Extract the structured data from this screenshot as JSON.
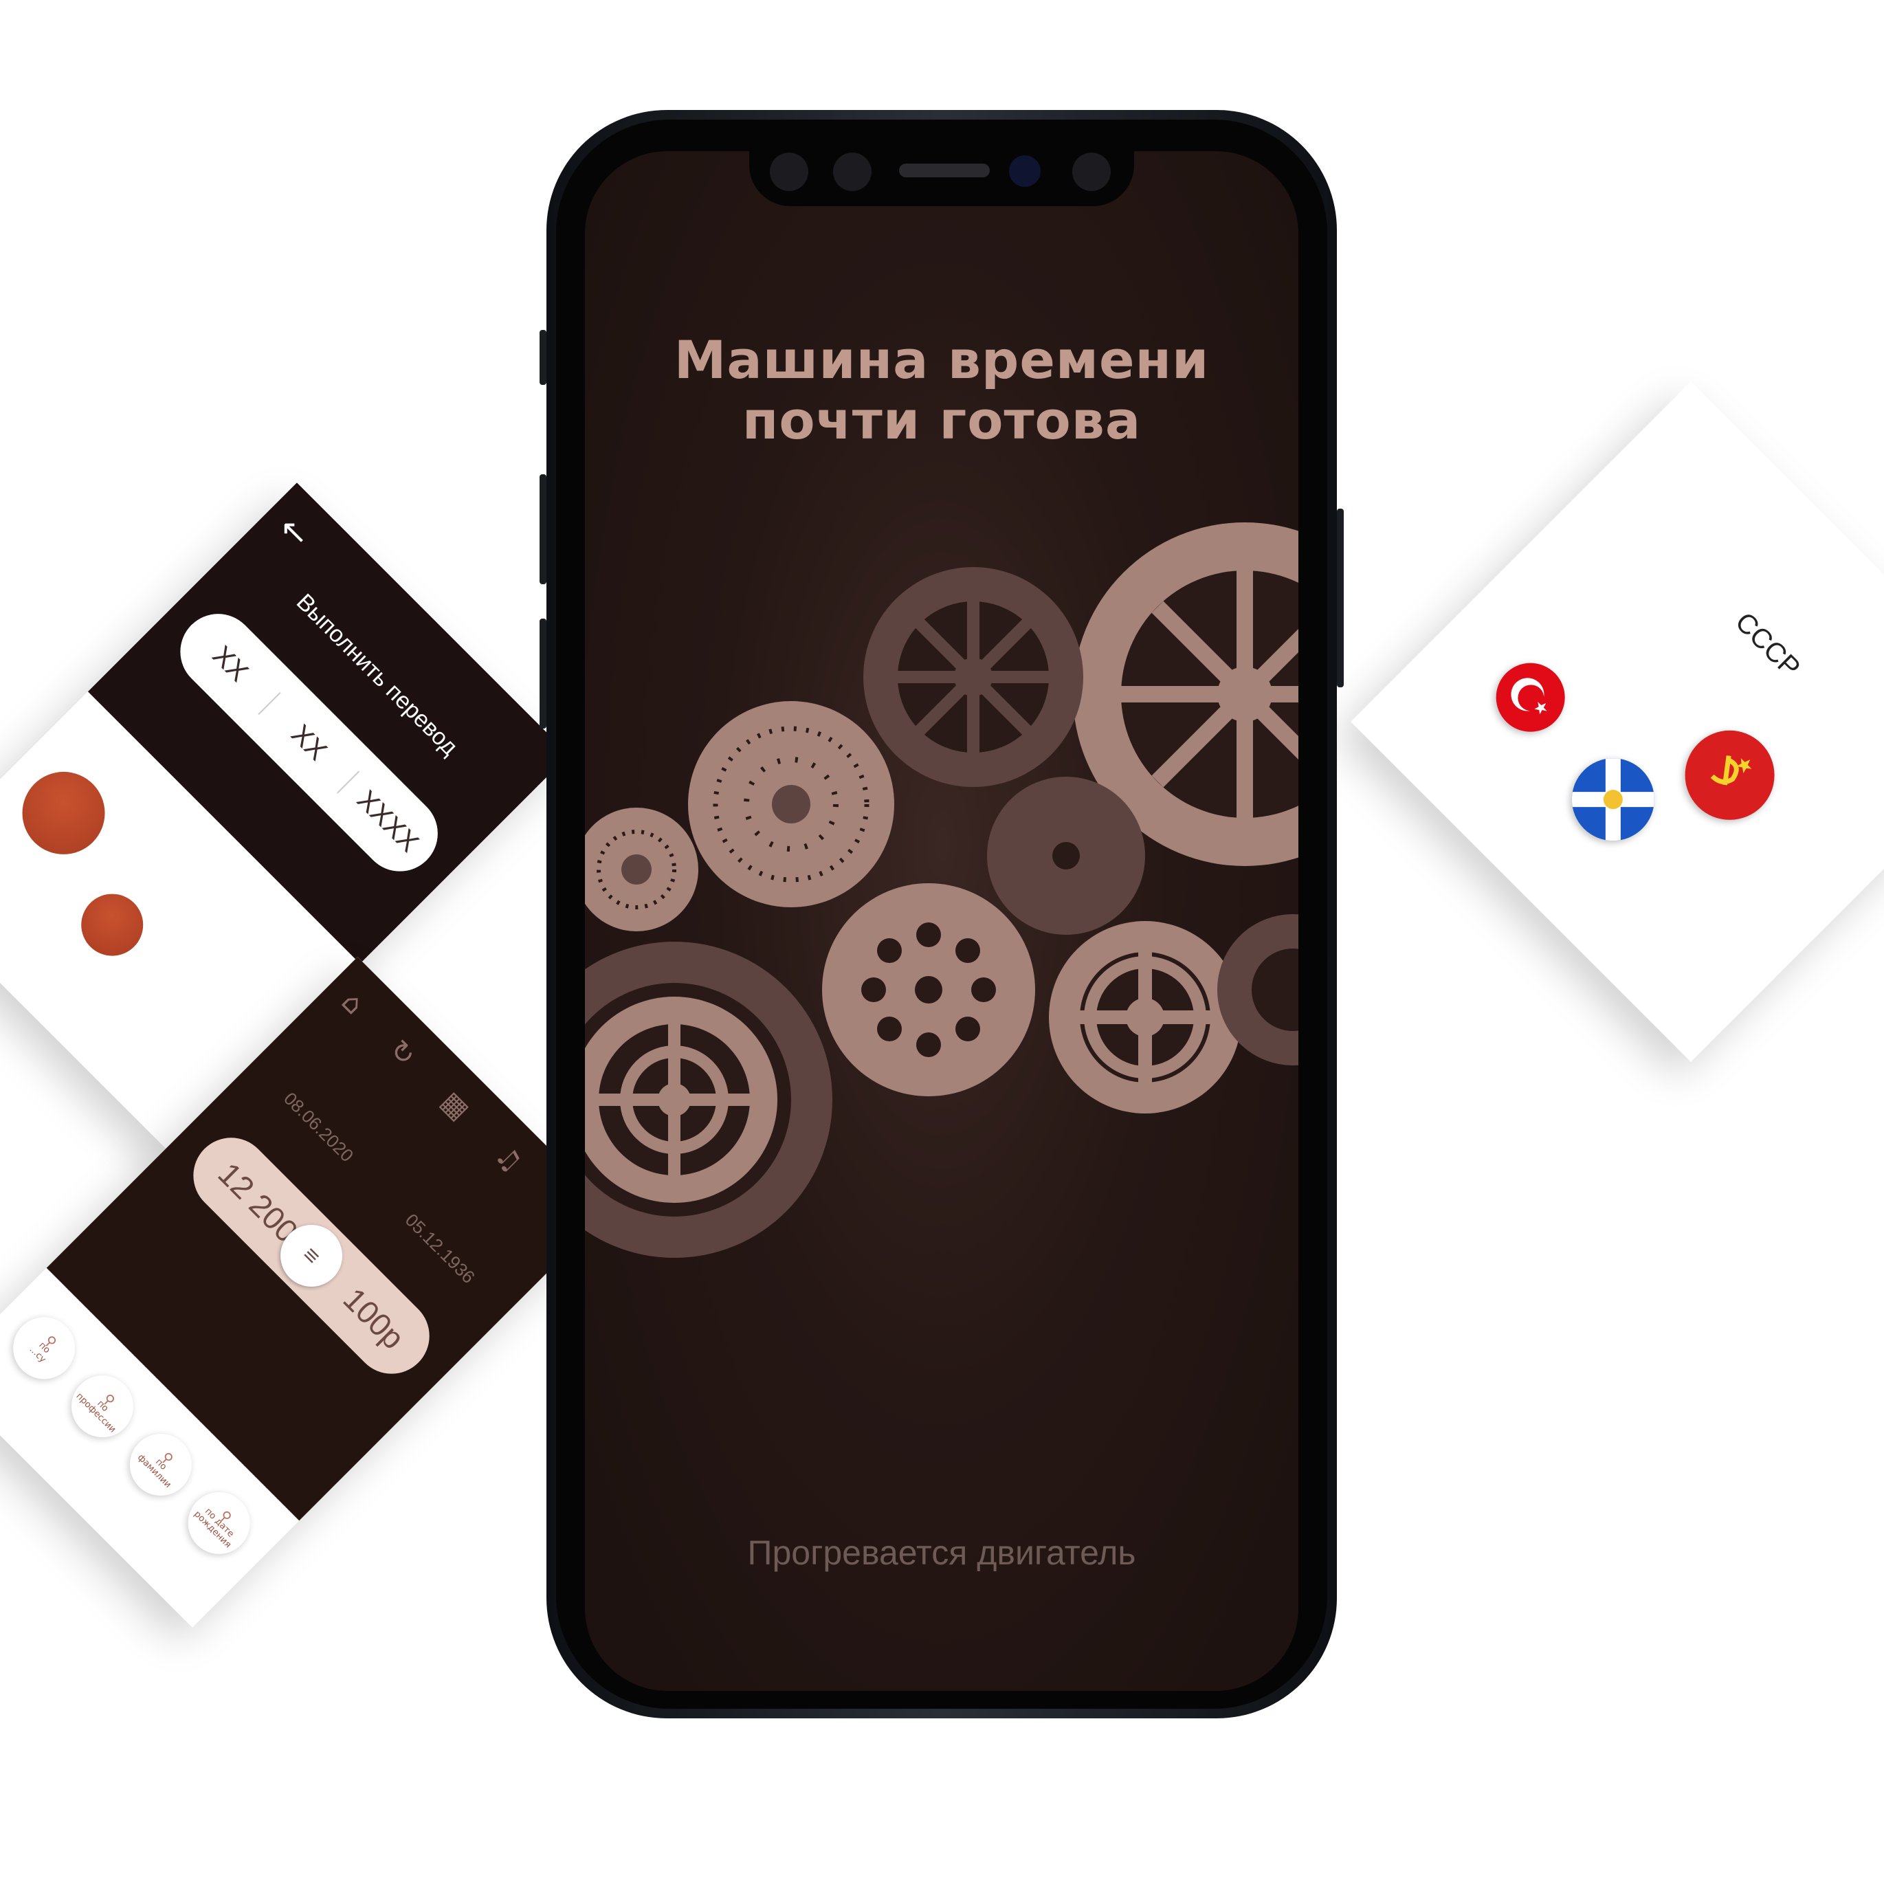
{
  "main_screen": {
    "title_line1": "Машина времени",
    "title_line2": "почти готова",
    "status": "Прогревается двигатель",
    "colors": {
      "background": "#1c110f",
      "gear_light": "#a68378",
      "gear_dark": "#5e4440",
      "title": "#c09a8c"
    }
  },
  "transfer_card": {
    "back_icon": "arrow-left-icon",
    "title": "Выполнить перевод",
    "fields": [
      "XX",
      "XX",
      "XXXX"
    ]
  },
  "search_card": {
    "nav_icons": [
      "home-icon",
      "history-icon",
      "id-card-icon",
      "bell-icon",
      "gear-icon"
    ],
    "date_from": "08.06.2020",
    "date_to": "05.12.1936",
    "amount_from": "12 200р",
    "amount_to": "100р",
    "chips": [
      {
        "line1": "по",
        "line2": "...су"
      },
      {
        "line1": "по",
        "line2": "профессии"
      },
      {
        "line1": "по",
        "line2": "фамилии"
      },
      {
        "line1": "по дате",
        "line2": "рождения"
      }
    ]
  },
  "flags_card": {
    "country": "СССР",
    "flags": [
      "turkey-flag",
      "scotland-flag",
      "ussr-flag"
    ]
  }
}
